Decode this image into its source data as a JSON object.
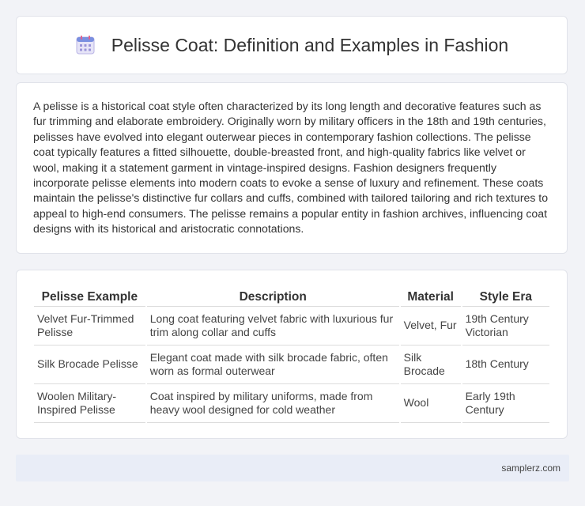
{
  "header": {
    "icon": "calendar-icon",
    "title": "Pelisse Coat: Definition and Examples in Fashion"
  },
  "intro": {
    "text": "A pelisse is a historical coat style often characterized by its long length and decorative features such as fur trimming and elaborate embroidery. Originally worn by military officers in the 18th and 19th centuries, pelisses have evolved into elegant outerwear pieces in contemporary fashion collections. The pelisse coat typically features a fitted silhouette, double-breasted front, and high-quality fabrics like velvet or wool, making it a statement garment in vintage-inspired designs. Fashion designers frequently incorporate pelisse elements into modern coats to evoke a sense of luxury and refinement. These coats maintain the pelisse's distinctive fur collars and cuffs, combined with tailored tailoring and rich textures to appeal to high-end consumers. The pelisse remains a popular entity in fashion archives, influencing coat designs with its historical and aristocratic connotations."
  },
  "table": {
    "headers": [
      "Pelisse Example",
      "Description",
      "Material",
      "Style Era"
    ],
    "rows": [
      [
        "Velvet Fur-Trimmed Pelisse",
        "Long coat featuring velvet fabric with luxurious fur trim along collar and cuffs",
        "Velvet, Fur",
        "19th Century Victorian"
      ],
      [
        "Silk Brocade Pelisse",
        "Elegant coat made with silk brocade fabric, often worn as formal outerwear",
        "Silk Brocade",
        "18th Century"
      ],
      [
        "Woolen Military-Inspired Pelisse",
        "Coat inspired by military uniforms, made from heavy wool designed for cold weather",
        "Wool",
        "Early 19th Century"
      ]
    ]
  },
  "footer": {
    "text": "samplerz.com"
  }
}
